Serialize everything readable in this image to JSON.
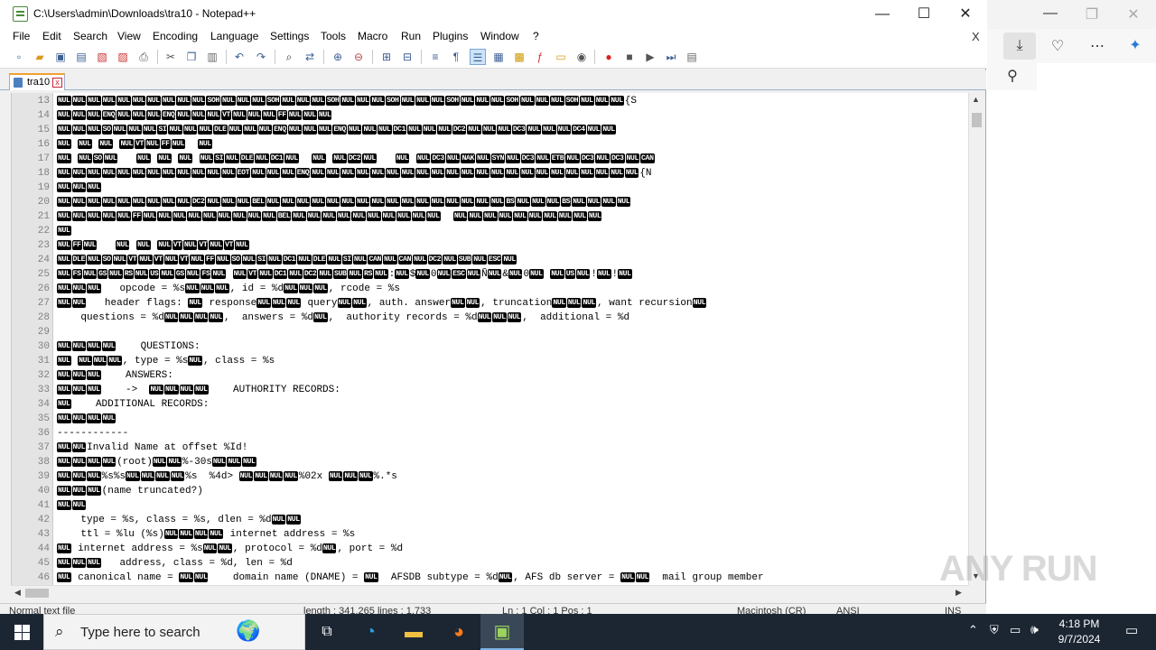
{
  "window": {
    "title": "C:\\Users\\admin\\Downloads\\tra10 - Notepad++",
    "minimize": "—",
    "maximize": "☐",
    "close": "✕"
  },
  "menu": {
    "items": [
      "File",
      "Edit",
      "Search",
      "View",
      "Encoding",
      "Language",
      "Settings",
      "Tools",
      "Macro",
      "Run",
      "Plugins",
      "Window",
      "?"
    ],
    "close": "X"
  },
  "tab": {
    "label": "tra10",
    "close": "x"
  },
  "editor": {
    "lines": [
      {
        "n": "13",
        "t": "{NUL}{NUL}{NUL}{NUL}{NUL}{NUL}{NUL}{NUL}{NUL}{NUL}{SOH}{NUL}{NUL}{NUL}{SOH}{NUL}{NUL}{NUL}{SOH}{NUL}{NUL}{NUL}{SOH}{NUL}{NUL}{NUL}{SOH}{NUL}{NUL}{NUL}{SOH}{NUL}{NUL}{NUL}{SOH}{NUL}{NUL}{NUL}{S"
      },
      {
        "n": "14",
        "t": "{NUL}{NUL}{NUL}{ENQ}{NUL}{NUL}{NUL}{ENQ}{NUL}{NUL}{NUL}{VT}{NUL}{NUL}{NUL}{FF}{NUL}{NUL}{NUL}"
      },
      {
        "n": "15",
        "t": "{NUL}{NUL}{NUL}{SO}{NUL}{NUL}{NUL}{SI}{NUL}{NUL}{NUL}{DLE}{NUL}{NUL}{NUL}{ENQ}{NUL}{NUL}{NUL}{ENQ}{NUL}{NUL}{NUL}{DC1}{NUL}{NUL}{NUL}{DC2}{NUL}{NUL}{NUL}{DC3}{NUL}{NUL}{NUL}{DC4}{NUL}{NUL}"
      },
      {
        "n": "16",
        "t": "{NUL} {NUL} {NUL} {NUL}{VT}{NUL}{FF}{NUL}  {NUL}"
      },
      {
        "n": "17",
        "t": "{NUL} {NUL}{SO}{NUL}   {NUL} {NUL} {NUL} {NUL}{SI}{NUL}{DLE}{NUL}{DC1}{NUL}  {NUL} {NUL}{DC2}{NUL}   {NUL} {NUL}{DC3}{NUL}{NAK}{NUL}{SYN}{NUL}{DC3}{NUL}{ETB}{NUL}{DC3}{NUL}{DC3}{NUL}{CAN}"
      },
      {
        "n": "18",
        "t": "{NUL}{NUL}{NUL}{NUL}{NUL}{NUL}{NUL}{NUL}{NUL}{NUL}{NUL}{NUL}{EOT}{NUL}{NUL}{NUL}{ENQ}{NUL}{NUL}{NUL}{NUL}{NUL}{NUL}{NUL}{NUL}{NUL}{NUL}{NUL}{NUL}{NUL}{NUL}{NUL}{NUL}{NUL}{NUL}{NUL}{NUL}{NUL}{NUL}{N"
      },
      {
        "n": "19",
        "t": "{NUL}{NUL}{NUL}"
      },
      {
        "n": "20",
        "t": "{NUL}{NUL}{NUL}{NUL}{NUL}{NUL}{NUL}{NUL}{NUL}{DC2}{NUL}{NUL}{NUL}{BEL}{NUL}{NUL}{NUL}{NUL}{NUL}{NUL}{NUL}{NUL}{NUL}{NUL}{NUL}{NUL}{NUL}{NUL}{NUL}{NUL}{BS}{NUL}{NUL}{NUL}{BS}{NUL}{NUL}{NUL}{NUL}"
      },
      {
        "n": "21",
        "t": "{NUL}{NUL}{NUL}{NUL}{NUL}{FF}{NUL}{NUL}{NUL}{NUL}{NUL}{NUL}{NUL}{NUL}{NUL}{BEL}{NUL}{NUL}{NUL}{NUL}{NUL}{NUL}{NUL}{NUL}{NUL}{NUL}  {NUL}{NUL}{NUL}{NUL}{NUL}{NUL}{NUL}{NUL}{NUL}{NUL}"
      },
      {
        "n": "22",
        "t": "{NUL}"
      },
      {
        "n": "23",
        "t": "{NUL}{FF}{NUL}   {NUL} {NUL} {NUL}{VT}{NUL}{VT}{NUL}{VT}{NUL}"
      },
      {
        "n": "24",
        "t": "{NUL}{DLE}{NUL}{SO}{NUL}{VT}{NUL}{VT}{NUL}{VT}{NUL}{FF}{NUL}{SO}{NUL}{SI}{NUL}{DC1}{NUL}{DLE}{NUL}{SI}{NUL}{CAN}{NUL}{CAN}{NUL}{DC2}{NUL}{SUB}{NUL}{ESC}{NUL}"
      },
      {
        "n": "25",
        "t": "{NUL}{FS}{NUL}{GS}{NUL}{RS}{NUL}{US}{NUL}{GS}{NUL}{FS}{NUL} {NUL}{VT}{NUL}{DC1}{NUL}{DC2}{NUL}{SUB}{NUL}{RS}{NUL}:{NUL}${NUL}0{NUL}{ESC}{NUL}Ñ{NUL}&{NUL}0{NUL} {NUL}{US}{NUL}!{NUL}!{NUL}"
      },
      {
        "n": "26",
        "t": "{NUL}{NUL}{NUL}   opcode = %s{NUL}{NUL}{NUL}, id = %d{NUL}{NUL}{NUL}, rcode = %s"
      },
      {
        "n": "27",
        "t": "{NUL}{NUL}   header flags: {NUL} response{NUL}{NUL}{NUL} query{NUL}{NUL}, auth. answer{NUL}{NUL}, truncation{NUL}{NUL}{NUL}, want recursion{NUL}"
      },
      {
        "n": "28",
        "t": "    questions = %d{NUL}{NUL}{NUL}{NUL},  answers = %d{NUL},  authority records = %d{NUL}{NUL}{NUL},  additional = %d"
      },
      {
        "n": "29",
        "t": ""
      },
      {
        "n": "30",
        "t": "{NUL}{NUL}{NUL}{NUL}    QUESTIONS:"
      },
      {
        "n": "31",
        "t": "{NUL} {NUL}{NUL}{NUL}, type = %s{NUL}, class = %s"
      },
      {
        "n": "32",
        "t": "{NUL}{NUL}{NUL}    ANSWERS:"
      },
      {
        "n": "33",
        "t": "{NUL}{NUL}{NUL}    ->  {NUL}{NUL}{NUL}{NUL}    AUTHORITY RECORDS:"
      },
      {
        "n": "34",
        "t": "{NUL}    ADDITIONAL RECORDS:"
      },
      {
        "n": "35",
        "t": "{NUL}{NUL}{NUL}{NUL}"
      },
      {
        "n": "36",
        "t": "------------"
      },
      {
        "n": "37",
        "t": "{NUL}{NUL}Invalid Name at offset %Id!"
      },
      {
        "n": "38",
        "t": "{NUL}{NUL}{NUL}{NUL}(root){NUL}{NUL}%-30s{NUL}{NUL}{NUL}"
      },
      {
        "n": "39",
        "t": "{NUL}{NUL}{NUL}%s%s{NUL}{NUL}{NUL}{NUL}%s  %4d> {NUL}{NUL}{NUL}{NUL}%02x {NUL}{NUL}{NUL}%.*s"
      },
      {
        "n": "40",
        "t": "{NUL}{NUL}{NUL}(name truncated?)"
      },
      {
        "n": "41",
        "t": "{NUL}{NUL}"
      },
      {
        "n": "42",
        "t": "    type = %s, class = %s, dlen = %d{NUL}{NUL}"
      },
      {
        "n": "43",
        "t": "    ttl = %lu (%s){NUL}{NUL}{NUL}{NUL} internet address = %s"
      },
      {
        "n": "44",
        "t": "{NUL} internet address = %s{NUL}{NUL}, protocol = %d{NUL}, port = %d"
      },
      {
        "n": "45",
        "t": "{NUL}{NUL}{NUL}   address, class = %d, len = %d"
      },
      {
        "n": "46",
        "t": "{NUL} canonical name = {NUL}{NUL}    domain name (DNAME) = {NUL}  AFSDB subtype = %d{NUL}, AFS db server = {NUL}{NUL}  mail group member"
      }
    ]
  },
  "status": {
    "doc_type": "Normal text file",
    "length": "length : 341,265    lines : 1,733",
    "position": "Ln : 1    Col : 1    Pos : 1",
    "eol": "Macintosh (CR)",
    "encoding": "ANSI",
    "mode": "INS"
  },
  "taskbar": {
    "search_placeholder": "Type here to search",
    "time": "4:18 PM",
    "date": "9/7/2024"
  },
  "watermark": "ANY RUN",
  "colors": {
    "accent": "#f0a030",
    "ctrl_bg": "#000000",
    "gutter": "#e4e4e4",
    "taskbar": "#1c2633"
  }
}
